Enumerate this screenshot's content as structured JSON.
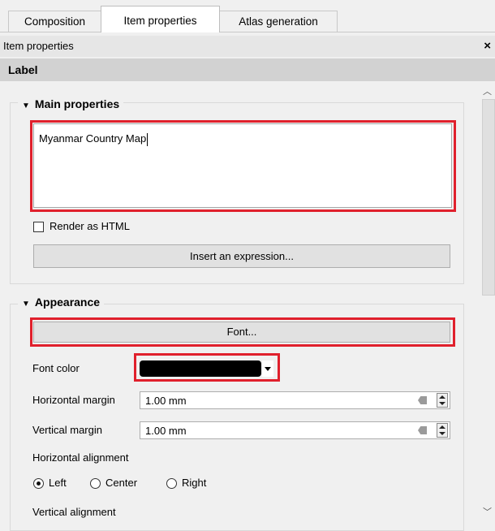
{
  "tabs": [
    {
      "label": "Composition"
    },
    {
      "label": "Item properties"
    },
    {
      "label": "Atlas generation"
    }
  ],
  "panel": {
    "title": "Item properties",
    "close": "×"
  },
  "section": {
    "title": "Label"
  },
  "main_properties": {
    "title": "Main properties",
    "label_text": "Myanmar Country Map",
    "render_html": {
      "label": "Render as HTML",
      "checked": false
    },
    "insert_expression": "Insert an expression..."
  },
  "appearance": {
    "title": "Appearance",
    "font_button": "Font...",
    "font_color": {
      "label": "Font color",
      "value": "#000000"
    },
    "horizontal_margin": {
      "label": "Horizontal margin",
      "value": "1.00 mm"
    },
    "vertical_margin": {
      "label": "Vertical margin",
      "value": "1.00 mm"
    },
    "horizontal_alignment": {
      "label": "Horizontal alignment",
      "options": [
        "Left",
        "Center",
        "Right"
      ],
      "selected": "Left"
    },
    "vertical_alignment": {
      "label": "Vertical alignment"
    }
  },
  "colors": {
    "highlight": "#e0202c"
  },
  "icons": {
    "collapse": "triangle-down-icon",
    "clear": "clear-field-icon",
    "spin": "spinbox-arrows-icon",
    "dropdown": "chevron-down-icon"
  }
}
